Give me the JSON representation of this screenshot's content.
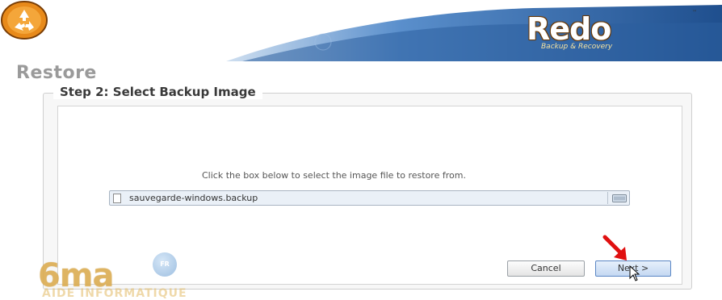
{
  "header": {
    "logo_text": "Redo",
    "logo_subtitle": "Backup & Recovery",
    "logo_tm": "™"
  },
  "page": {
    "title": "Restore"
  },
  "step": {
    "title": "Step 2: Select Backup Image",
    "instruction": "Click the box below to select the image file to restore from."
  },
  "file_picker": {
    "value": "sauvegarde-windows.backup",
    "icons": [
      "file-icon",
      "folder-open-icon"
    ]
  },
  "buttons": {
    "cancel_label": "Cancel",
    "next_label": "Next >"
  },
  "watermark": {
    "main": "6ma",
    "badge": "FR",
    "sub": "AIDE INFORMATIQUE"
  },
  "colors": {
    "banner_blue": "#2c5f9e",
    "logo_orange": "#e88a1a",
    "annotation_red": "#e01010",
    "next_button_border": "#5a86c4"
  }
}
